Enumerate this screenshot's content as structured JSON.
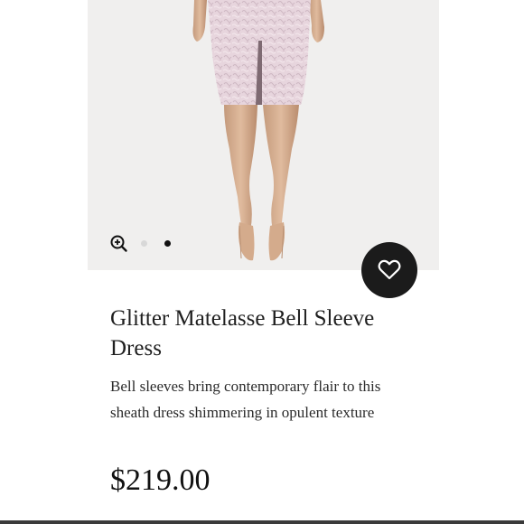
{
  "product": {
    "title": "Glitter Matelasse Bell Sleeve Dress",
    "description": "Bell sleeves bring contemporary flair to this sheath dress shimmering in opulent texture",
    "price": "$219.00"
  },
  "gallery": {
    "slide_count": 2,
    "active_index": 1,
    "zoom_icon": "zoom-in-icon",
    "favorite_icon": "heart-icon"
  },
  "colors": {
    "image_bg": "#f0efee",
    "dress": "#e6d3dc",
    "favorite_button": "#1b1b1b",
    "active_dot": "#111111",
    "inactive_dot": "#d8d8d8"
  }
}
